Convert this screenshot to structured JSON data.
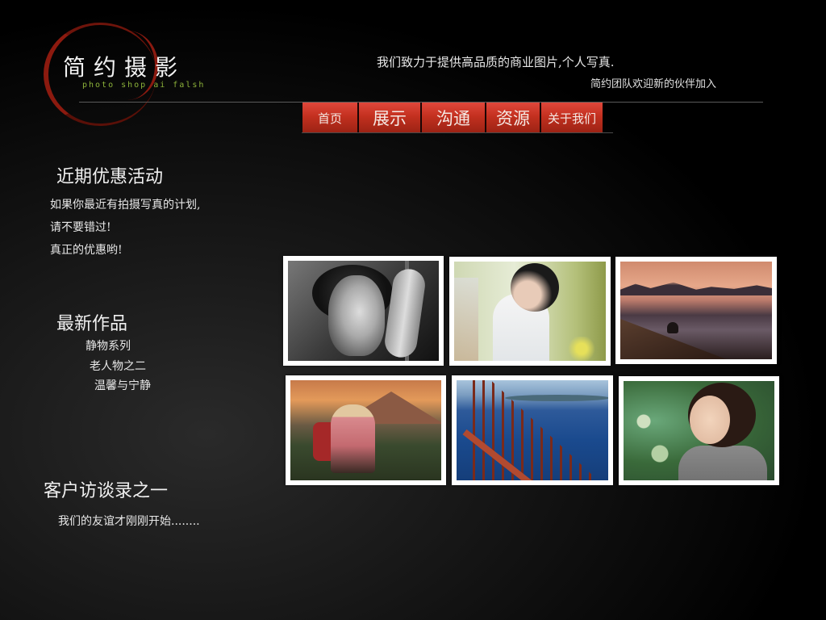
{
  "brand": {
    "title": "简约摄影",
    "subtitle": "photo shop  ai falsh"
  },
  "header": {
    "slogan_line1": "我们致力于提供高品质的商业图片,个人写真.",
    "slogan_line2": "简约团队欢迎新的伙伴加入"
  },
  "nav": {
    "items": [
      {
        "label": "首页"
      },
      {
        "label": "展示"
      },
      {
        "label": "沟通"
      },
      {
        "label": "资源"
      },
      {
        "label": "关于我们"
      }
    ]
  },
  "promo": {
    "title": "近期优惠活动",
    "lines": [
      "如果你最近有拍摄写真的计划,",
      "请不要错过!",
      "真正的优惠哟!"
    ]
  },
  "works": {
    "title": "最新作品",
    "items": [
      "静物系列",
      "老人物之二",
      "温馨与宁静"
    ]
  },
  "interview": {
    "title": "客户访谈录之一",
    "text": "我们的友谊才刚刚开始........"
  },
  "gallery": {
    "photos": [
      {
        "subject": "black-white-woman-portrait"
      },
      {
        "subject": "girl-white-shirt"
      },
      {
        "subject": "sunset-lake-heron"
      },
      {
        "subject": "hiker-mountain-sunset"
      },
      {
        "subject": "bridge-railing-sea"
      },
      {
        "subject": "woman-looking-up"
      }
    ]
  },
  "colors": {
    "accent_red": "#c3301f",
    "logo_sub_green": "#8db33a",
    "background": "#000000"
  }
}
